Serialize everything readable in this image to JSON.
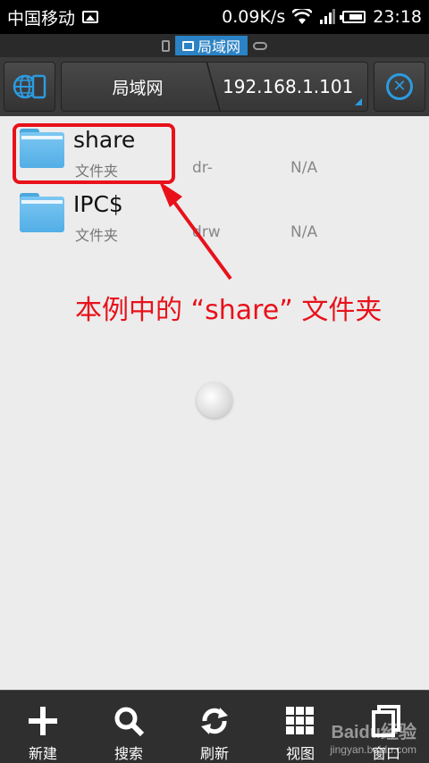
{
  "status_bar": {
    "carrier": "中国移动",
    "speed": "0.09K/s",
    "time": "23:18"
  },
  "location_bar": {
    "active_label": "局域网"
  },
  "toolbar": {
    "breadcrumb_root": "局域网",
    "breadcrumb_current": "192.168.1.101"
  },
  "files": [
    {
      "name": "share",
      "type": "文件夹",
      "perm": "dr-",
      "size": "N/A"
    },
    {
      "name": "IPC$",
      "type": "文件夹",
      "perm": "drw",
      "size": "N/A"
    }
  ],
  "annotation": {
    "text": "本例中的 “share” 文件夹",
    "color": "#e8111a"
  },
  "bottom_bar": {
    "items": [
      {
        "label": "新建",
        "icon": "plus-icon"
      },
      {
        "label": "搜索",
        "icon": "search-icon"
      },
      {
        "label": "刷新",
        "icon": "refresh-icon"
      },
      {
        "label": "视图",
        "icon": "grid-icon"
      },
      {
        "label": "窗口",
        "icon": "window-icon"
      }
    ]
  },
  "watermark": {
    "brand": "Baidu经验",
    "url": "jingyan.baidu.com"
  },
  "colors": {
    "accent": "#2b82c4",
    "folder": "#5ab4ea",
    "annotation_red": "#e8111a"
  }
}
